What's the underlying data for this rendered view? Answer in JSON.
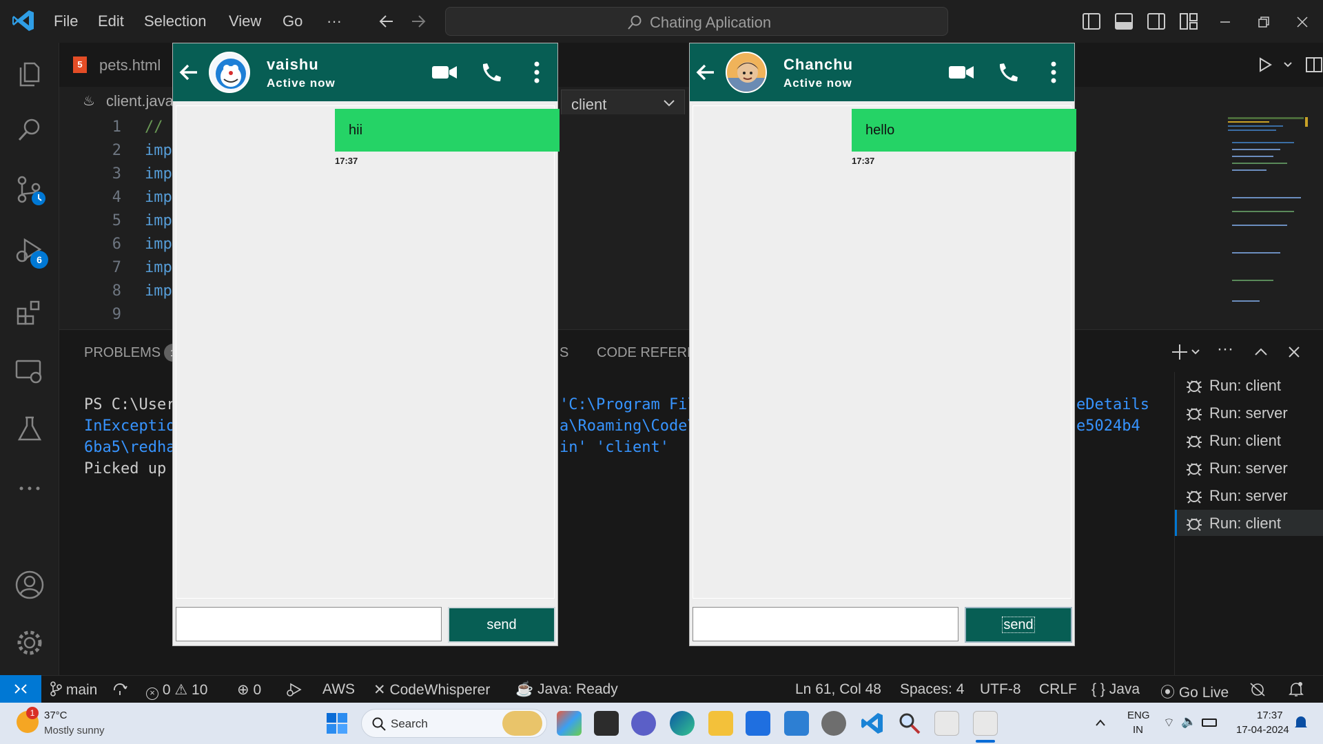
{
  "menu": [
    "File",
    "Edit",
    "Selection",
    "View",
    "Go",
    "···"
  ],
  "command_center": "Chating Aplication",
  "tabs": {
    "pets": "pets.html",
    "client": "client.java"
  },
  "client_dropdown": "client",
  "editor": {
    "line_numbers": [
      "1",
      "2",
      "3",
      "4",
      "5",
      "6",
      "7",
      "8",
      "9"
    ],
    "code": [
      "//",
      "imp",
      "imp",
      "imp",
      "imp",
      "imp",
      "imp",
      "imp",
      ""
    ]
  },
  "panel": {
    "tabs": [
      "PROBLEMS",
      "S",
      "CODE REFEREN"
    ],
    "problems_count": "1",
    "terminal_left": [
      "PS C:\\User",
      "InExceptio",
      "6ba5\\redha",
      "Picked up"
    ],
    "terminal_mid": [
      "'C:\\Program Fil",
      "a\\Roaming\\Code\\",
      "in' 'client'"
    ],
    "terminal_right": [
      "eDetails",
      "e5024b4"
    ]
  },
  "run_list": [
    "Run: client",
    "Run: server",
    "Run: client",
    "Run: server",
    "Run: server",
    "Run: client"
  ],
  "activity_badge": "6",
  "status": {
    "branch": "main",
    "errors": "0",
    "warnings": "10",
    "ports": "0",
    "aws": "AWS",
    "codewhisperer": "CodeWhisperer",
    "java_ready": "Java: Ready",
    "position": "Ln 61, Col 48",
    "spaces": "Spaces: 4",
    "encoding": "UTF-8",
    "eol": "CRLF",
    "language": "{ } Java",
    "golive": "Go Live"
  },
  "chats": [
    {
      "name": "vaishu",
      "status": "Active now",
      "message": "hii",
      "time": "17:37",
      "send": "send"
    },
    {
      "name": "Chanchu",
      "status": "Active now",
      "message": "hello",
      "time": "17:37",
      "send": "send"
    }
  ],
  "taskbar": {
    "temperature": "37°C",
    "weather": "Mostly sunny",
    "weather_badge": "1",
    "search": "Search",
    "lang1": "ENG",
    "lang2": "IN",
    "time": "17:37",
    "date": "17-04-2024"
  },
  "colors": {
    "chat_header": "#075e54",
    "bubble": "#25d366",
    "vscode_accent": "#0078d4"
  }
}
